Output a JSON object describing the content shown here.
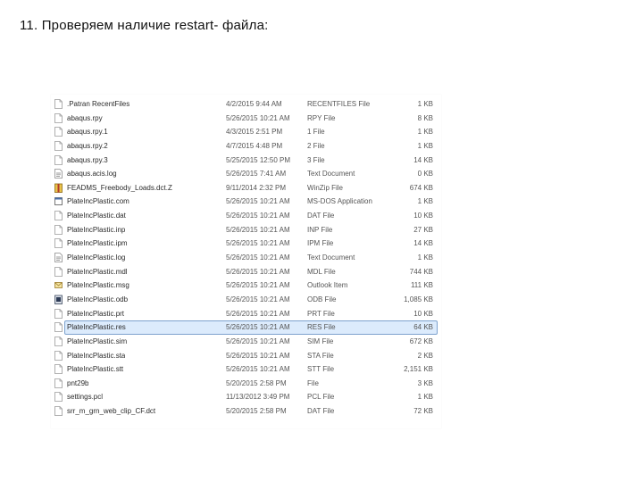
{
  "slide": {
    "title": "11. Проверяем наличие restart- файла:"
  },
  "explorer": {
    "selected_row": 16,
    "files": [
      {
        "name": ".Patran RecentFiles",
        "date": "4/2/2015 9:44 AM",
        "type": "RECENTFILES File",
        "size": "1 KB",
        "icon": "document-icon"
      },
      {
        "name": "abaqus.rpy",
        "date": "5/26/2015 10:21 AM",
        "type": "RPY File",
        "size": "8 KB",
        "icon": "document-icon"
      },
      {
        "name": "abaqus.rpy.1",
        "date": "4/3/2015 2:51 PM",
        "type": "1 File",
        "size": "1 KB",
        "icon": "document-icon"
      },
      {
        "name": "abaqus.rpy.2",
        "date": "4/7/2015 4:48 PM",
        "type": "2 File",
        "size": "1 KB",
        "icon": "document-icon"
      },
      {
        "name": "abaqus.rpy.3",
        "date": "5/25/2015 12:50 PM",
        "type": "3 File",
        "size": "14 KB",
        "icon": "document-icon"
      },
      {
        "name": "abaqus.acis.log",
        "date": "5/26/2015 7:41 AM",
        "type": "Text Document",
        "size": "0 KB",
        "icon": "text-document-icon"
      },
      {
        "name": "FEADMS_Freebody_Loads.dct.Z",
        "date": "9/11/2014 2:32 PM",
        "type": "WinZip File",
        "size": "674 KB",
        "icon": "winzip-icon"
      },
      {
        "name": "PlateIncPlastic.com",
        "date": "5/26/2015 10:21 AM",
        "type": "MS-DOS Application",
        "size": "1 KB",
        "icon": "application-icon"
      },
      {
        "name": "PlateIncPlastic.dat",
        "date": "5/26/2015 10:21 AM",
        "type": "DAT File",
        "size": "10 KB",
        "icon": "document-icon"
      },
      {
        "name": "PlateIncPlastic.inp",
        "date": "5/26/2015 10:21 AM",
        "type": "INP File",
        "size": "27 KB",
        "icon": "document-icon"
      },
      {
        "name": "PlateIncPlastic.ipm",
        "date": "5/26/2015 10:21 AM",
        "type": "IPM File",
        "size": "14 KB",
        "icon": "document-icon"
      },
      {
        "name": "PlateIncPlastic.log",
        "date": "5/26/2015 10:21 AM",
        "type": "Text Document",
        "size": "1 KB",
        "icon": "text-document-icon"
      },
      {
        "name": "PlateIncPlastic.mdl",
        "date": "5/26/2015 10:21 AM",
        "type": "MDL File",
        "size": "744 KB",
        "icon": "document-icon"
      },
      {
        "name": "PlateIncPlastic.msg",
        "date": "5/26/2015 10:21 AM",
        "type": "Outlook Item",
        "size": "111 KB",
        "icon": "outlook-item-icon"
      },
      {
        "name": "PlateIncPlastic.odb",
        "date": "5/26/2015 10:21 AM",
        "type": "ODB File",
        "size": "1,085 KB",
        "icon": "odb-file-icon"
      },
      {
        "name": "PlateIncPlastic.prt",
        "date": "5/26/2015 10:21 AM",
        "type": "PRT File",
        "size": "10 KB",
        "icon": "document-icon"
      },
      {
        "name": "PlateIncPlastic.res",
        "date": "5/26/2015 10:21 AM",
        "type": "RES File",
        "size": "64 KB",
        "icon": "document-icon"
      },
      {
        "name": "PlateIncPlastic.sim",
        "date": "5/26/2015 10:21 AM",
        "type": "SIM File",
        "size": "672 KB",
        "icon": "document-icon"
      },
      {
        "name": "PlateIncPlastic.sta",
        "date": "5/26/2015 10:21 AM",
        "type": "STA File",
        "size": "2 KB",
        "icon": "document-icon"
      },
      {
        "name": "PlateIncPlastic.stt",
        "date": "5/26/2015 10:21 AM",
        "type": "STT File",
        "size": "2,151 KB",
        "icon": "document-icon"
      },
      {
        "name": "pnt29b",
        "date": "5/20/2015 2:58 PM",
        "type": "File",
        "size": "3 KB",
        "icon": "document-icon"
      },
      {
        "name": "settings.pcl",
        "date": "11/13/2012 3:49 PM",
        "type": "PCL File",
        "size": "1 KB",
        "icon": "document-icon"
      },
      {
        "name": "srr_m_grn_web_clip_CF.dct",
        "date": "5/20/2015 2:58 PM",
        "type": "DAT File",
        "size": "72 KB",
        "icon": "document-icon"
      }
    ]
  }
}
